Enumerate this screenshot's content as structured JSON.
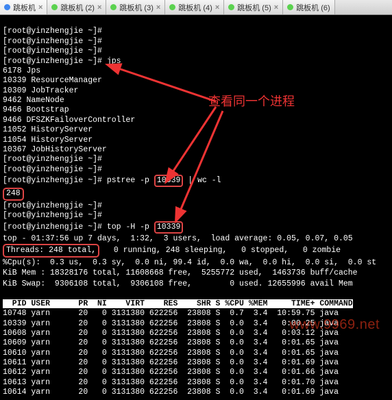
{
  "tabs": [
    {
      "label": "跳板机",
      "active": true
    },
    {
      "label": "跳板机 (2)"
    },
    {
      "label": "跳板机 (3)"
    },
    {
      "label": "跳板机 (4)"
    },
    {
      "label": "跳板机 (5)"
    },
    {
      "label": "跳板机 (6)"
    }
  ],
  "prompt": "[root@yinzhengjie ~]#",
  "pre_cmds": [
    "",
    "",
    "",
    "jps"
  ],
  "jps": [
    "6178 Jps",
    "10339 ResourceManager",
    "10309 JobTracker",
    "9462 NameNode",
    "9466 Bootstrap",
    "9466 DFSZKFailoverController",
    "11052 HistoryServer",
    "11054 HistoryServer",
    "10367 JobHistoryServer"
  ],
  "pstree_cmd_pre": "pstree -p ",
  "pstree_pid": "10339",
  "pstree_cmd_post": " | wc -l",
  "pstree_out": "248",
  "top_cmd_pre": "top -H -p ",
  "top_pid": "10339",
  "top_summary": {
    "l1": "top - 01:37:56 up 7 days,  1:32,  3 users,  load average: 0.05, 0.07, 0.05",
    "threads": "Threads: 248 total,",
    "threads_rest": "   0 running, 248 sleeping,   0 stopped,   0 zombie",
    "cpu": "%Cpu(s):  0.3 us,  0.3 sy,  0.0 ni, 99.4 id,  0.0 wa,  0.0 hi,  0.0 si,  0.0 st",
    "mem": "KiB Mem : 18328176 total, 11608668 free,  5255772 used,  1463736 buff/cache",
    "swp": "KiB Swap:  9306108 total,  9306108 free,        0 used. 12655996 avail Mem"
  },
  "table_header": "  PID USER      PR  NI    VIRT    RES    SHR S %CPU %MEM     TIME+ COMMAND",
  "rows": [
    "10748 yarn      20   0 3131380 622256  23808 S  0.7  3.4  10:59.75 java",
    "10339 yarn      20   0 3131380 622256  23808 S  0.0  3.4   0:00.25 java",
    "10608 yarn      20   0 3131380 622256  23808 S  0.0  3.4   0:03.12 java",
    "10609 yarn      20   0 3131380 622256  23808 S  0.0  3.4   0:01.65 java",
    "10610 yarn      20   0 3131380 622256  23808 S  0.0  3.4   0:01.65 java",
    "10611 yarn      20   0 3131380 622256  23808 S  0.0  3.4   0:01.69 java",
    "10612 yarn      20   0 3131380 622256  23808 S  0.0  3.4   0:01.66 java",
    "10613 yarn      20   0 3131380 622256  23808 S  0.0  3.4   0:01.70 java",
    "10614 yarn      20   0 3131380 622256  23808 S  0.0  3.4   0:01.69 java"
  ],
  "callout": "查看同一个进程",
  "watermark": "www.9969.net"
}
